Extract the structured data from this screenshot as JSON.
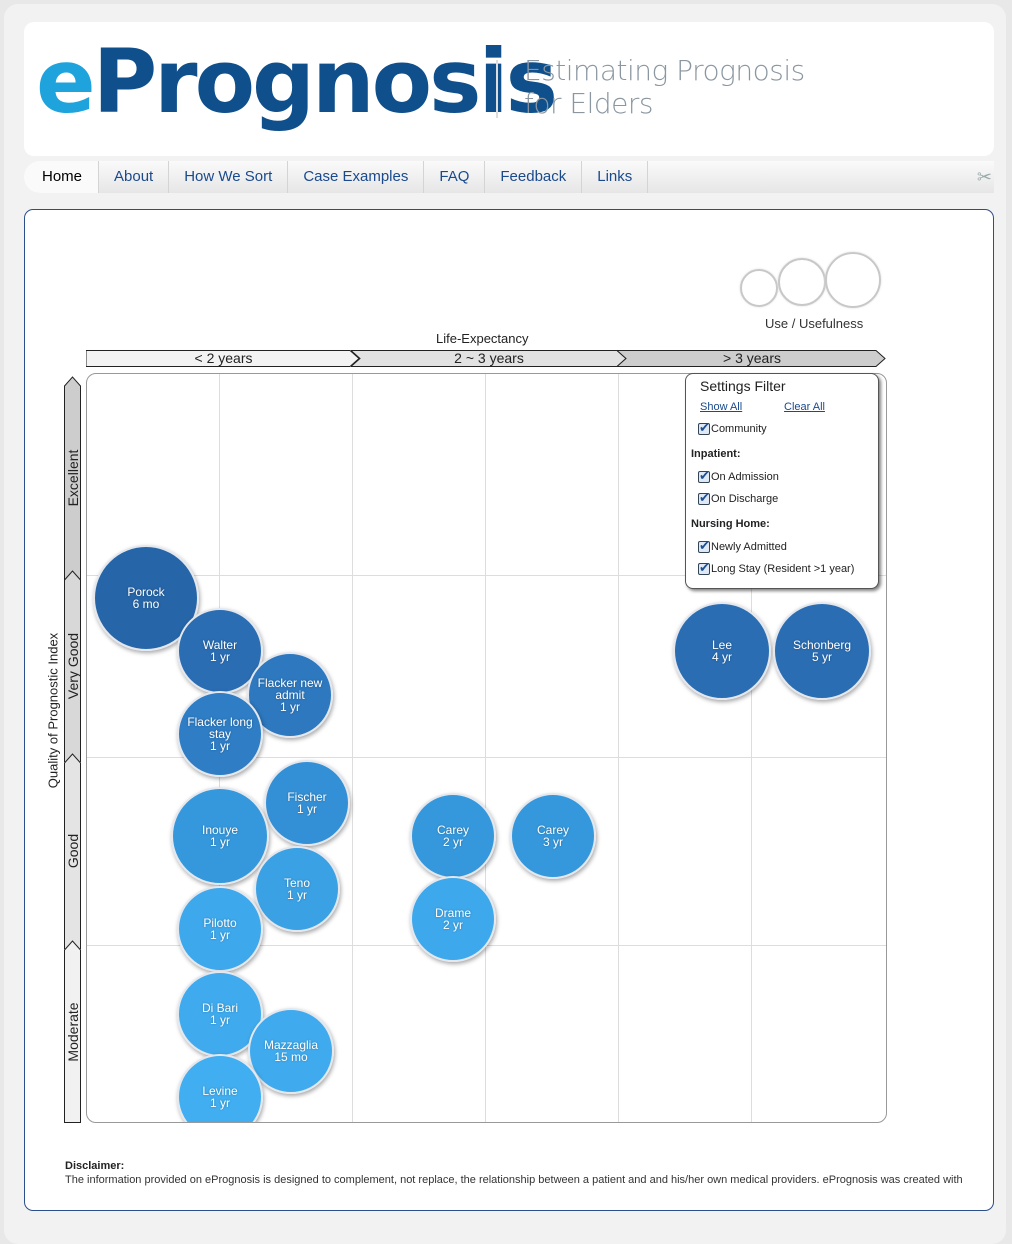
{
  "header": {
    "logo_e": "e",
    "logo_rest": "Prognosis",
    "tagline_line1": "Estimating Prognosis",
    "tagline_line2": "for Elders"
  },
  "nav": {
    "items": [
      "Home",
      "About",
      "How We Sort",
      "Case Examples",
      "FAQ",
      "Feedback",
      "Links"
    ],
    "active": "Home",
    "tools_icon": "tools-icon"
  },
  "legend": {
    "label": "Use / Usefulness"
  },
  "xaxis": {
    "title": "Life-Expectancy",
    "segments": [
      "< 2 years",
      "2 ~ 3 years",
      "> 3 years"
    ]
  },
  "yaxis": {
    "title": "Quality of Prognostic Index",
    "segments": [
      "Excellent",
      "Very Good",
      "Good",
      "Moderate"
    ]
  },
  "bubbles": [
    {
      "name": "Porock",
      "value": "6 mo",
      "color": "#2565a8"
    },
    {
      "name": "Walter",
      "value": "1 yr",
      "color": "#2a6db3"
    },
    {
      "name": "Flacker new admit",
      "value": "1 yr",
      "color": "#2d78bf"
    },
    {
      "name": "Flacker long stay",
      "value": "1 yr",
      "color": "#2e7dc5"
    },
    {
      "name": "Fischer",
      "value": "1 yr",
      "color": "#3490d6"
    },
    {
      "name": "Inouye",
      "value": "1 yr",
      "color": "#3598dc"
    },
    {
      "name": "Teno",
      "value": "1 yr",
      "color": "#3aa1e5"
    },
    {
      "name": "Pilotto",
      "value": "1 yr",
      "color": "#3ea8ec"
    },
    {
      "name": "Di Bari",
      "value": "1 yr",
      "color": "#3fabee"
    },
    {
      "name": "Mazzaglia",
      "value": "15 mo",
      "color": "#3fabee"
    },
    {
      "name": "Levine",
      "value": "1 yr",
      "color": "#40aef0"
    },
    {
      "name": "Carey",
      "value": "2 yr",
      "color": "#3598dc"
    },
    {
      "name": "Carey",
      "value": "3 yr",
      "color": "#3598dc"
    },
    {
      "name": "Drame",
      "value": "2 yr",
      "color": "#3ea8ec"
    },
    {
      "name": "Lee",
      "value": "4 yr",
      "color": "#2a6db3"
    },
    {
      "name": "Schonberg",
      "value": "5 yr",
      "color": "#2a6db3"
    }
  ],
  "filter": {
    "title": "Settings Filter",
    "show_all": "Show All",
    "clear_all": "Clear All",
    "community": "Community",
    "inpatient": "Inpatient:",
    "on_admission": "On Admission",
    "on_discharge": "On Discharge",
    "nursing_home": "Nursing Home:",
    "newly_admitted": "Newly Admitted",
    "long_stay": "Long Stay (Resident >1 year)",
    "checked": [
      true,
      true,
      true,
      true,
      true
    ]
  },
  "disclaimer": {
    "heading": "Disclaimer:",
    "text": "The information provided on ePrognosis is designed to complement, not replace, the relationship between a patient and and his/her own medical providers. ePrognosis was created with"
  }
}
